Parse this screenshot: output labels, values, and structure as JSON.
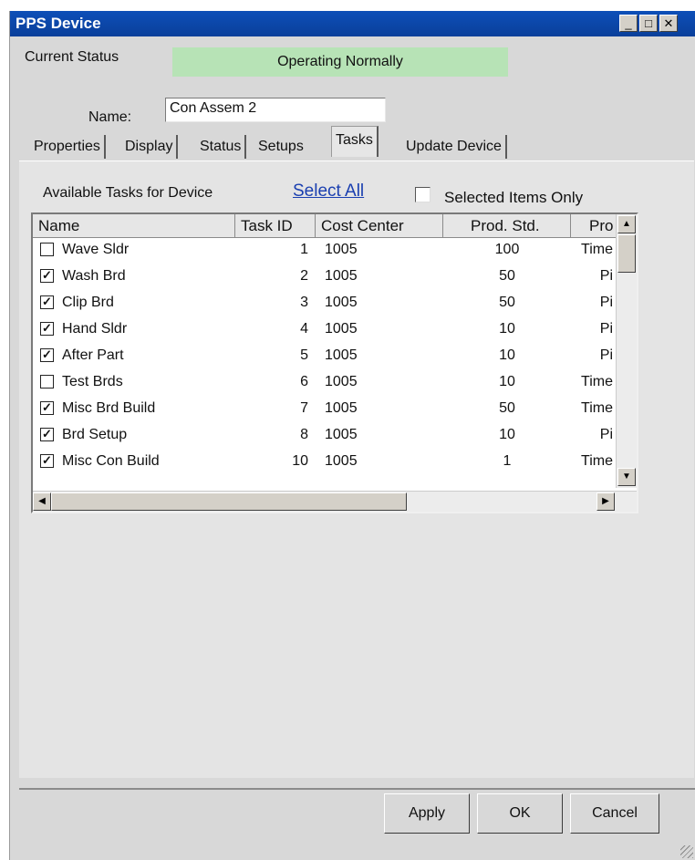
{
  "window": {
    "title": "PPS Device"
  },
  "status": {
    "label": "Current Status",
    "value": "Operating Normally"
  },
  "name": {
    "label": "Name:",
    "value": "Con Assem 2"
  },
  "tabs": [
    "Properties",
    "Display",
    "Status",
    "Setups",
    "Tasks",
    "Update Device"
  ],
  "active_tab": "Tasks",
  "tasks": {
    "label": "Available Tasks for Device",
    "select_all": "Select All",
    "selected_only": "Selected Items Only",
    "columns": [
      "Name",
      "Task ID",
      "Cost Center",
      "Prod. Std.",
      "Pro"
    ],
    "rows": [
      {
        "checked": false,
        "name": "Wave Sldr",
        "id": "1",
        "cost": "1005",
        "std": "100",
        "pro": "Time"
      },
      {
        "checked": true,
        "name": "Wash Brd",
        "id": "2",
        "cost": "1005",
        "std": "50",
        "pro": "Pi"
      },
      {
        "checked": true,
        "name": "Clip Brd",
        "id": "3",
        "cost": "1005",
        "std": "50",
        "pro": "Pi"
      },
      {
        "checked": true,
        "name": "Hand Sldr",
        "id": "4",
        "cost": "1005",
        "std": "10",
        "pro": "Pi"
      },
      {
        "checked": true,
        "name": "After Part",
        "id": "5",
        "cost": "1005",
        "std": "10",
        "pro": "Pi"
      },
      {
        "checked": false,
        "name": "Test Brds",
        "id": "6",
        "cost": "1005",
        "std": "10",
        "pro": "Time"
      },
      {
        "checked": true,
        "name": "Misc Brd Build",
        "id": "7",
        "cost": "1005",
        "std": "50",
        "pro": "Time"
      },
      {
        "checked": true,
        "name": "Brd Setup",
        "id": "8",
        "cost": "1005",
        "std": "10",
        "pro": "Pi"
      },
      {
        "checked": true,
        "name": "Misc Con Build",
        "id": "10",
        "cost": "1005",
        "std": "1",
        "pro": "Time"
      }
    ]
  },
  "buttons": {
    "apply": "Apply",
    "ok": "OK",
    "cancel": "Cancel"
  },
  "colors": {
    "titlebar": "#0d4fb8",
    "status_ok": "#b7e3b6",
    "link": "#1a3fb0"
  }
}
